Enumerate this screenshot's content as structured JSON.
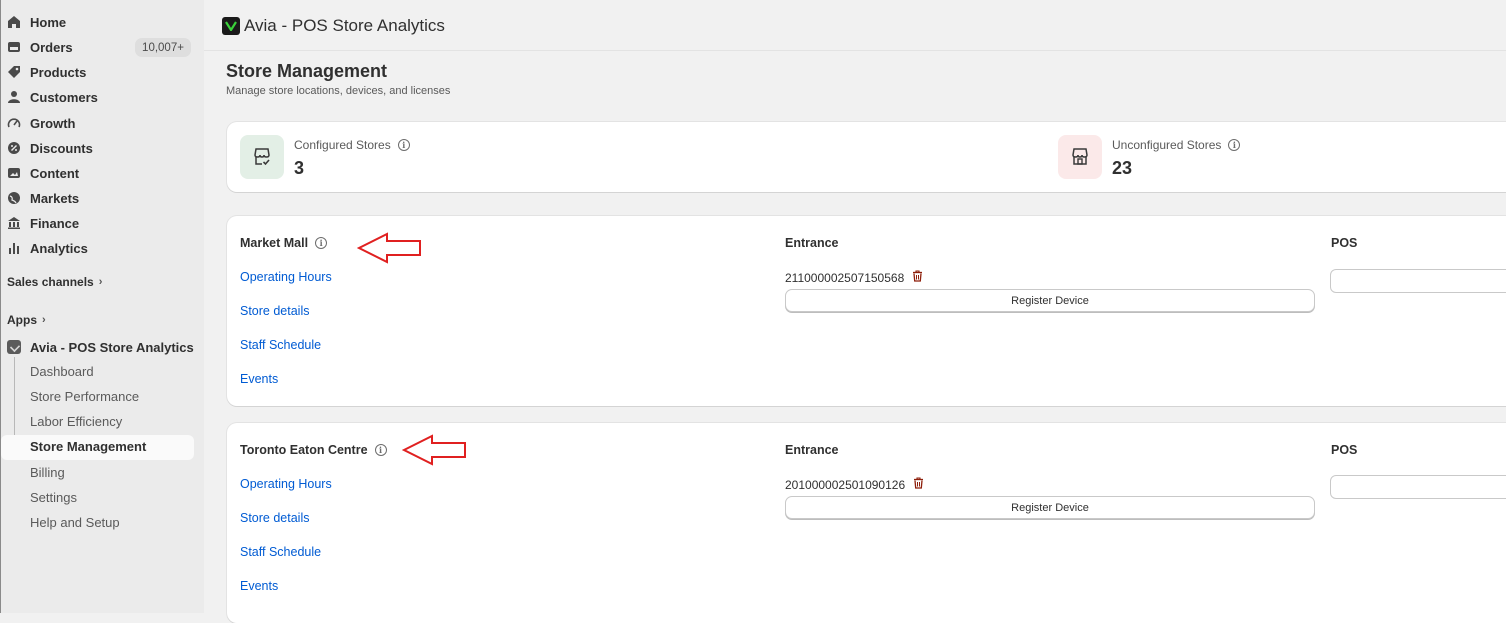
{
  "sidebar": {
    "items": [
      {
        "label": "Home",
        "icon": "home-icon"
      },
      {
        "label": "Orders",
        "icon": "orders-icon",
        "badge": "10,007+"
      },
      {
        "label": "Products",
        "icon": "tag-icon"
      },
      {
        "label": "Customers",
        "icon": "person-icon"
      },
      {
        "label": "Growth",
        "icon": "gauge-icon"
      },
      {
        "label": "Discounts",
        "icon": "discount-icon"
      },
      {
        "label": "Content",
        "icon": "image-icon"
      },
      {
        "label": "Markets",
        "icon": "globe-icon"
      },
      {
        "label": "Finance",
        "icon": "bank-icon"
      },
      {
        "label": "Analytics",
        "icon": "bar-chart-icon"
      }
    ],
    "sales_channels": "Sales channels",
    "apps": "Apps",
    "app_name": "Avia - POS Store Analytics",
    "app_pages": [
      "Dashboard",
      "Store Performance",
      "Labor Efficiency",
      "Store Management"
    ],
    "bottom_items": [
      "Billing",
      "Settings",
      "Help and Setup"
    ]
  },
  "topbar": {
    "app_title": "Avia - POS Store Analytics"
  },
  "page": {
    "title": "Store Management",
    "subtitle": "Manage store locations, devices, and licenses"
  },
  "stats": {
    "configured_label": "Configured Stores",
    "configured_value": "3",
    "unconfigured_label": "Unconfigured Stores",
    "unconfigured_value": "23"
  },
  "stores": [
    {
      "name": "Market Mall",
      "links": [
        "Operating Hours",
        "Store details",
        "Staff Schedule",
        "Events"
      ],
      "entrance_label": "Entrance",
      "serial": "211000002507150568",
      "register_label": "Register Device",
      "pos_label": "POS"
    },
    {
      "name": "Toronto Eaton Centre",
      "links": [
        "Operating Hours",
        "Store details",
        "Staff Schedule",
        "Events"
      ],
      "entrance_label": "Entrance",
      "serial": "201000002501090126",
      "register_label": "Register Device",
      "pos_label": "POS"
    }
  ],
  "colors": {
    "accent_link": "#005bd3",
    "annotation_arrow": "#e02020",
    "trash": "#8e1f0b"
  }
}
